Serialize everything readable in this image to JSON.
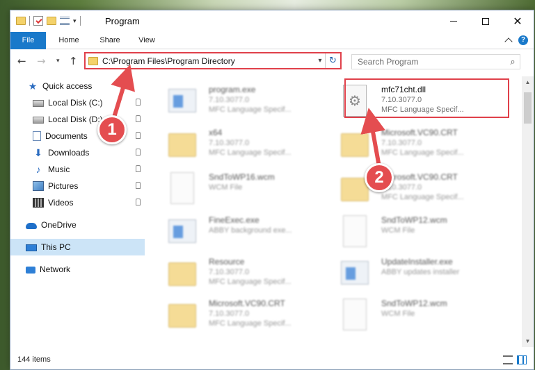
{
  "window": {
    "title": "Program",
    "minimize": "",
    "maximize": "",
    "close": "✕"
  },
  "ribbon": {
    "tabs": [
      "File",
      "Home",
      "Share",
      "View"
    ],
    "help": "?"
  },
  "address": {
    "path": "C:\\Program Files\\Program Directory",
    "dropdown": "▾",
    "refresh": "↻"
  },
  "search": {
    "placeholder": "Search Program",
    "icon": "⌕"
  },
  "nav": {
    "back": "←",
    "forward": "→",
    "recent": "▾",
    "up": "↑"
  },
  "sidebar": {
    "items": [
      {
        "label": "Quick access",
        "icon": "star-icon",
        "pinned": false
      },
      {
        "label": "Local Disk (C:)",
        "icon": "disk-icon",
        "pinned": true
      },
      {
        "label": "Local Disk (D:)",
        "icon": "disk-icon",
        "pinned": true
      },
      {
        "label": "Documents",
        "icon": "documents-icon",
        "pinned": true
      },
      {
        "label": "Downloads",
        "icon": "downloads-icon",
        "pinned": true
      },
      {
        "label": "Music",
        "icon": "music-icon",
        "pinned": true
      },
      {
        "label": "Pictures",
        "icon": "pictures-icon",
        "pinned": true
      },
      {
        "label": "Videos",
        "icon": "videos-icon",
        "pinned": true
      },
      {
        "label": "OneDrive",
        "icon": "onedrive-icon",
        "pinned": false
      },
      {
        "label": "This PC",
        "icon": "pc-icon",
        "pinned": false,
        "selected": true
      },
      {
        "label": "Network",
        "icon": "network-icon",
        "pinned": false
      }
    ],
    "glyphs": {
      "star": "★",
      "down": "⬇",
      "music": "♪"
    }
  },
  "files": [
    {
      "name": "program.exe",
      "meta1": "7.10.3077.0",
      "meta2": "MFC Language Specif...",
      "kind": "exe"
    },
    {
      "name": "mfc71cht.dll",
      "meta1": "7.10.3077.0",
      "meta2": "MFC Language Specif...",
      "kind": "dll"
    },
    {
      "name": "x64",
      "meta1": "7.10.3077.0",
      "meta2": "MFC Language Specif...",
      "kind": "folder"
    },
    {
      "name": "Microsoft.VC90.CRT",
      "meta1": "7.10.3077.0",
      "meta2": "MFC Language Specif...",
      "kind": "folder"
    },
    {
      "name": "SndToWP16.wcm",
      "meta1": "WCM File",
      "meta2": "",
      "kind": "doc"
    },
    {
      "name": "Microsoft.VC90.CRT",
      "meta1": "7.10.3077.0",
      "meta2": "MFC Language Specif...",
      "kind": "folder"
    },
    {
      "name": "FineExec.exe",
      "meta1": "ABBY background exe...",
      "meta2": "",
      "kind": "exe"
    },
    {
      "name": "SndToWP12.wcm",
      "meta1": "WCM File",
      "meta2": "",
      "kind": "doc"
    },
    {
      "name": "Resource",
      "meta1": "7.10.3077.0",
      "meta2": "MFC Language Specif...",
      "kind": "folder"
    },
    {
      "name": "UpdateInstaller.exe",
      "meta1": "ABBY updates installer",
      "meta2": "",
      "kind": "exe"
    },
    {
      "name": "Microsoft.VC90.CRT",
      "meta1": "7.10.3077.0",
      "meta2": "MFC Language Specif...",
      "kind": "folder"
    },
    {
      "name": "SndToWP12.wcm",
      "meta1": "WCM File",
      "meta2": "",
      "kind": "doc"
    }
  ],
  "status": {
    "count": "144 items"
  },
  "annotations": {
    "badge1": "1",
    "badge2": "2"
  },
  "colors": {
    "accent": "#1979ca",
    "annotation": "#e0404a",
    "selected": "#cce4f7"
  }
}
